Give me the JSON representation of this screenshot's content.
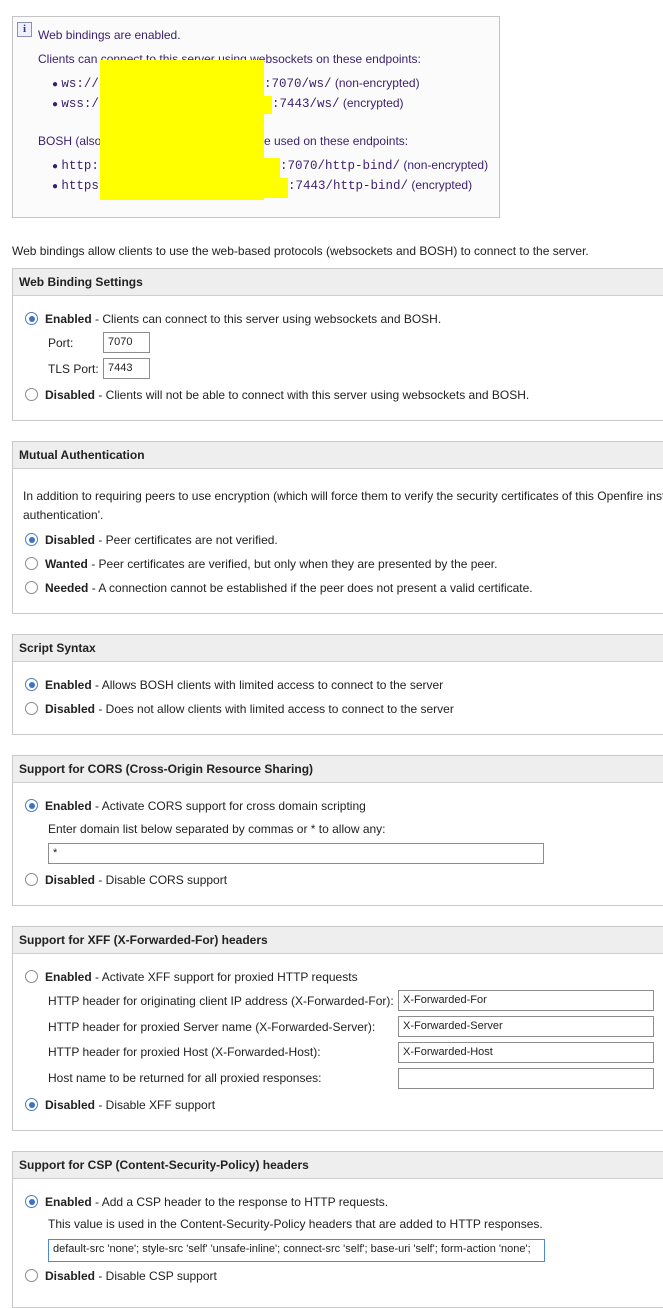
{
  "info": {
    "title": "Web bindings are enabled.",
    "ws_heading": "Clients can connect to this server using websockets on these endpoints:",
    "ws_items": [
      {
        "prefix": "ws://",
        "suffix": ":7070/ws/",
        "note": "(non-encrypted)"
      },
      {
        "prefix": "wss:/",
        "suffix": ":7443/ws/",
        "note": "(encrypted)"
      }
    ],
    "bosh_heading_start": "BOSH (also",
    "bosh_heading_end": "e used on these endpoints:",
    "bosh_items": [
      {
        "prefix": "http:",
        "suffix": ":7070/http-bind/",
        "note": "(non-encrypted)"
      },
      {
        "prefix": "https",
        "suffix": ":7443/http-bind/",
        "note": "(encrypted)"
      }
    ]
  },
  "intro": "Web bindings allow clients to use the web-based protocols (websockets and BOSH) to connect to the server.",
  "web_binding": {
    "title": "Web Binding Settings",
    "enabled_label": "Enabled",
    "enabled_desc": " - Clients can connect to this server using websockets and BOSH.",
    "port_label": "Port:",
    "port_value": "7070",
    "tls_label": "TLS Port:",
    "tls_value": "7443",
    "disabled_label": "Disabled",
    "disabled_desc": " - Clients will not be able to connect with this server using websockets and BOSH."
  },
  "mutual": {
    "title": "Mutual Authentication",
    "text_line1": "In addition to requiring peers to use encryption (which will force them to verify the security certificates of this Openfire inst",
    "text_line2": "authentication'.",
    "options": [
      {
        "label": "Disabled",
        "desc": " - Peer certificates are not verified."
      },
      {
        "label": "Wanted",
        "desc": " - Peer certificates are verified, but only when they are presented by the peer."
      },
      {
        "label": "Needed",
        "desc": " - A connection cannot be established if the peer does not present a valid certificate."
      }
    ]
  },
  "script": {
    "title": "Script Syntax",
    "enabled_label": "Enabled",
    "enabled_desc": " - Allows BOSH clients with limited access to connect to the server",
    "disabled_label": "Disabled",
    "disabled_desc": " - Does not allow clients with limited access to connect to the server"
  },
  "cors": {
    "title": "Support for CORS (Cross-Origin Resource Sharing)",
    "enabled_label": "Enabled",
    "enabled_desc": " - Activate CORS support for cross domain scripting",
    "domain_hint": "Enter domain list below separated by commas or * to allow any:",
    "domain_value": "*",
    "disabled_label": "Disabled",
    "disabled_desc": " - Disable CORS support"
  },
  "xff": {
    "title": "Support for XFF (X-Forwarded-For) headers",
    "enabled_label": "Enabled",
    "enabled_desc": " - Activate XFF support for proxied HTTP requests",
    "fields": [
      {
        "label": "HTTP header for originating client IP address (X-Forwarded-For):",
        "value": "X-Forwarded-For"
      },
      {
        "label": "HTTP header for proxied Server name (X-Forwarded-Server):",
        "value": "X-Forwarded-Server"
      },
      {
        "label": "HTTP header for proxied Host (X-Forwarded-Host):",
        "value": "X-Forwarded-Host"
      },
      {
        "label": "Host name to be returned for all proxied responses:",
        "value": ""
      }
    ],
    "disabled_label": "Disabled",
    "disabled_desc": " - Disable XFF support"
  },
  "csp": {
    "title": "Support for CSP (Content-Security-Policy) headers",
    "enabled_label": "Enabled",
    "enabled_desc": " - Add a CSP header to the response to HTTP requests.",
    "hint": "This value is used in the Content-Security-Policy headers that are added to HTTP responses.",
    "value": "default-src 'none'; style-src 'self' 'unsafe-inline'; connect-src 'self'; base-uri 'self'; form-action 'none';",
    "disabled_label": "Disabled",
    "disabled_desc": " - Disable CSP support"
  }
}
